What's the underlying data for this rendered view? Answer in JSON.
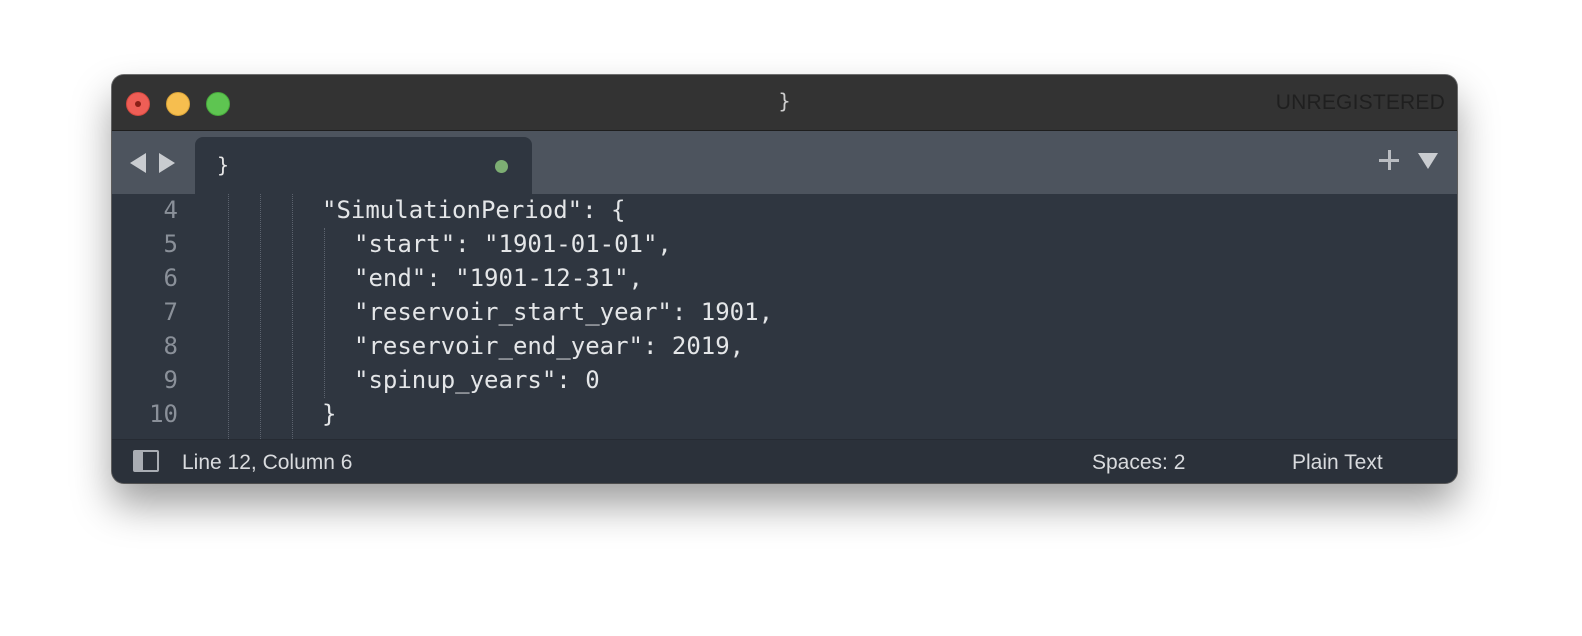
{
  "window": {
    "title": "}",
    "registration_label": "UNREGISTERED"
  },
  "tabs": [
    {
      "label": "}",
      "modified": true
    }
  ],
  "editor": {
    "lines": [
      {
        "number": "4",
        "text": "\"SimulationPeriod\": {"
      },
      {
        "number": "5",
        "text": "\"start\": \"1901-01-01\","
      },
      {
        "number": "6",
        "text": "\"end\": \"1901-12-31\","
      },
      {
        "number": "7",
        "text": "\"reservoir_start_year\": 1901,"
      },
      {
        "number": "8",
        "text": "\"reservoir_end_year\": 2019,"
      },
      {
        "number": "9",
        "text": "\"spinup_years\": 0"
      },
      {
        "number": "10",
        "text": "}"
      }
    ]
  },
  "statusbar": {
    "position": "Line 12, Column 6",
    "indentation": "Spaces: 2",
    "syntax": "Plain Text"
  },
  "icons": {
    "sidebar_toggle": "sidebar-toggle-icon",
    "nav_back": "arrow-left-icon",
    "nav_forward": "arrow-right-icon",
    "new_tab": "plus-icon",
    "tab_menu": "dropdown-icon"
  },
  "colors": {
    "editor_background": "#2f3640",
    "tabbar_background": "#4d545e",
    "titlebar_background": "#333333",
    "close_button": "#ee5e56",
    "minimize_button": "#f6be4f",
    "maximize_button": "#5ec551",
    "modified_dot": "#7dae73"
  }
}
